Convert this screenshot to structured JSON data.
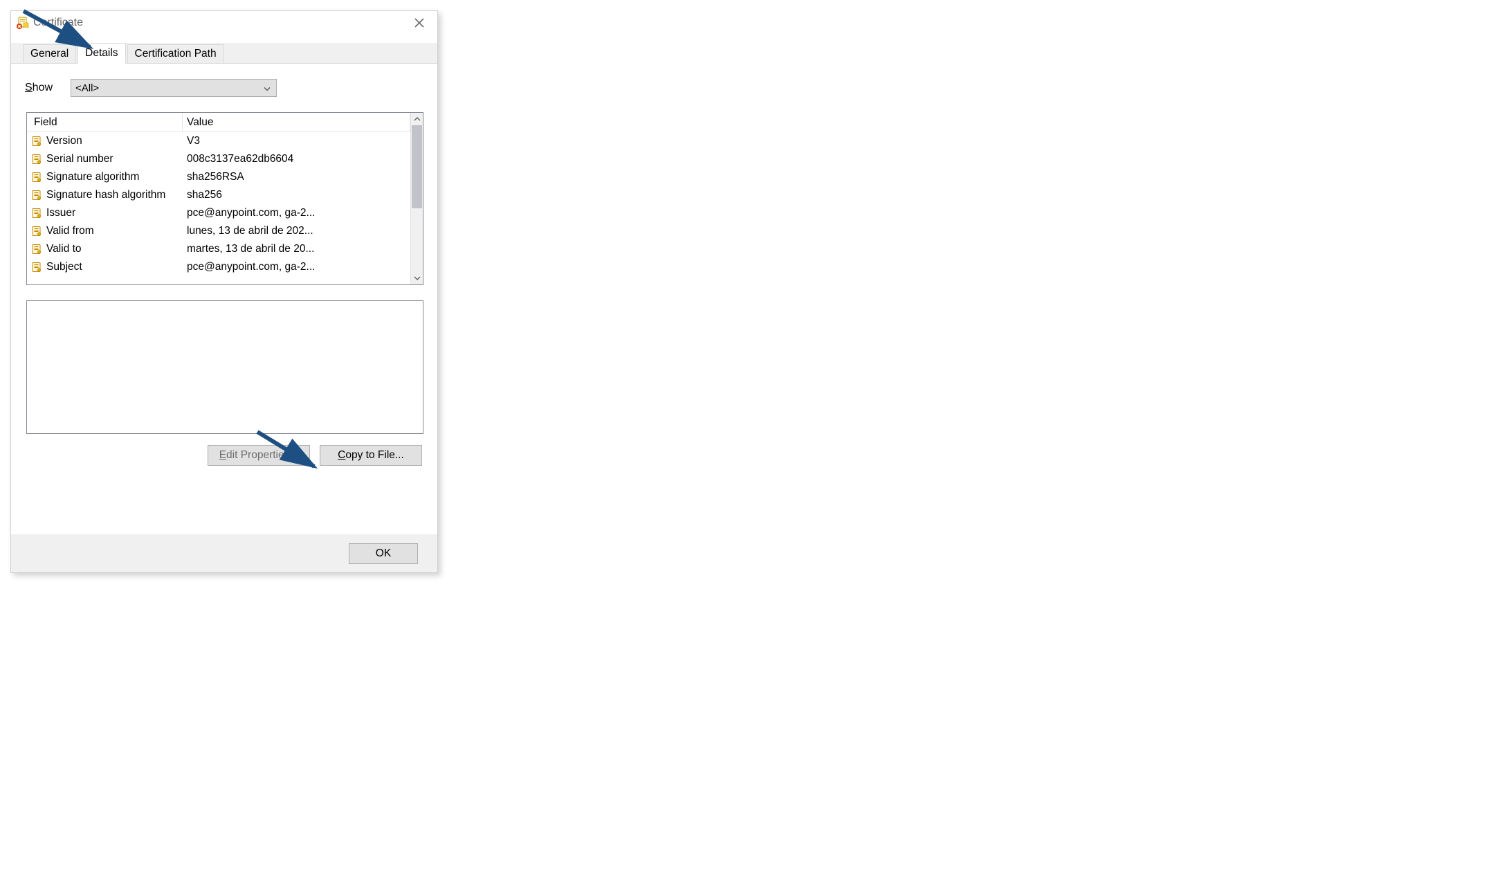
{
  "window": {
    "title": "Certificate"
  },
  "tabs": {
    "general": "General",
    "details": "Details",
    "certpath": "Certification Path"
  },
  "show": {
    "label_pre": "S",
    "label_post": "how",
    "value": "<All>"
  },
  "headers": {
    "field": "Field",
    "value": "Value"
  },
  "rows": [
    {
      "field": "Version",
      "value": "V3"
    },
    {
      "field": "Serial number",
      "value": "008c3137ea62db6604"
    },
    {
      "field": "Signature algorithm",
      "value": "sha256RSA"
    },
    {
      "field": "Signature hash algorithm",
      "value": "sha256"
    },
    {
      "field": "Issuer",
      "value": "pce@anypoint.com, ga-2..."
    },
    {
      "field": "Valid from",
      "value": "lunes, 13 de abril de 202..."
    },
    {
      "field": "Valid to",
      "value": "martes, 13 de abril de 20..."
    },
    {
      "field": "Subject",
      "value": "pce@anypoint.com, ga-2..."
    }
  ],
  "buttons": {
    "edit_pre": "E",
    "edit_post": "dit Properties...",
    "copy_pre": "C",
    "copy_post": "opy to File...",
    "ok": "OK"
  }
}
